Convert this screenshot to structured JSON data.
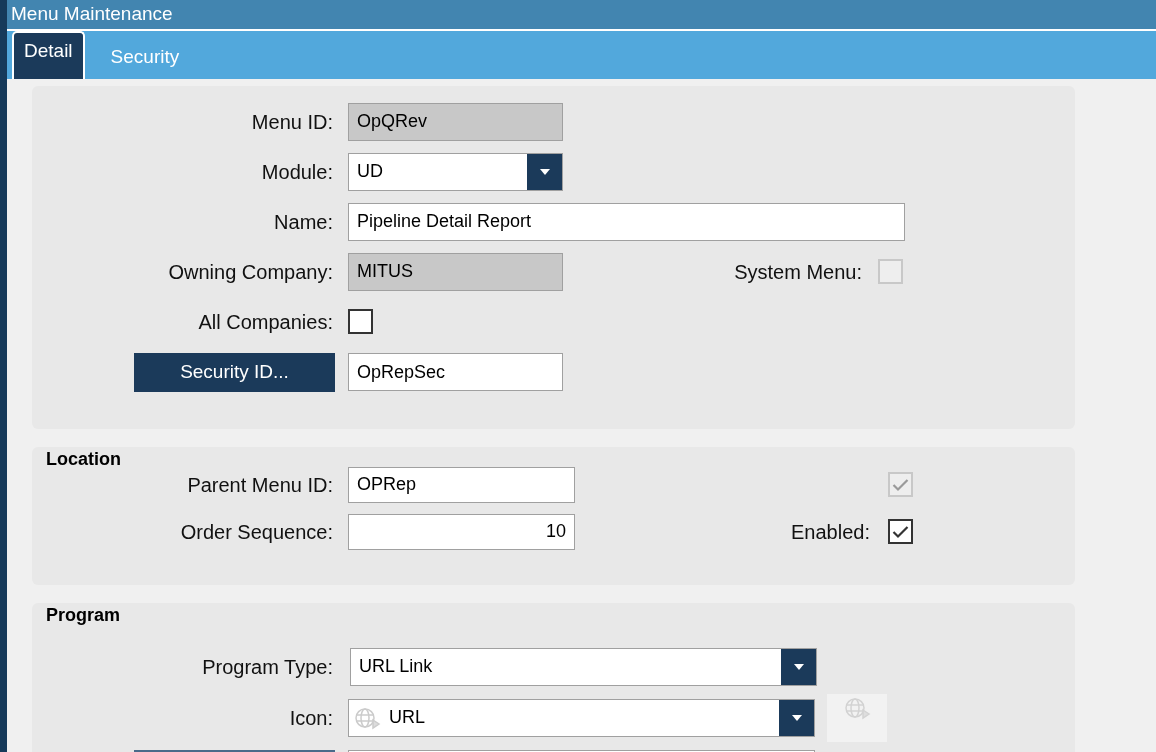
{
  "window": {
    "title": "Menu Maintenance"
  },
  "tabs": [
    {
      "label": "Detail",
      "selected": true
    },
    {
      "label": "Security",
      "selected": false
    }
  ],
  "general": {
    "menu_id": {
      "label": "Menu ID:",
      "value": "OpQRev",
      "disabled": true
    },
    "module": {
      "label": "Module:",
      "value": "UD"
    },
    "name": {
      "label": "Name:",
      "value": "Pipeline Detail Report"
    },
    "owning_company": {
      "label": "Owning Company:",
      "value": "MITUS",
      "disabled": true
    },
    "system_menu": {
      "label": "System Menu:",
      "checked": false,
      "disabled": true
    },
    "all_companies": {
      "label": "All Companies:",
      "checked": false,
      "disabled": false
    },
    "security_id": {
      "button": "Security ID...",
      "value": "OpRepSec"
    }
  },
  "location": {
    "heading": "Location",
    "parent_menu_id": {
      "label": "Parent Menu ID:",
      "value": "OPRep"
    },
    "unlabeled_checkbox": {
      "checked": true,
      "disabled": true
    },
    "order_sequence": {
      "label": "Order Sequence:",
      "value": "10"
    },
    "enabled": {
      "label": "Enabled:",
      "checked": true,
      "disabled": false
    }
  },
  "program": {
    "heading": "Program",
    "program_type": {
      "label": "Program Type:",
      "value": "URL Link"
    },
    "icon": {
      "label": "Icon:",
      "value": "URL"
    }
  }
}
